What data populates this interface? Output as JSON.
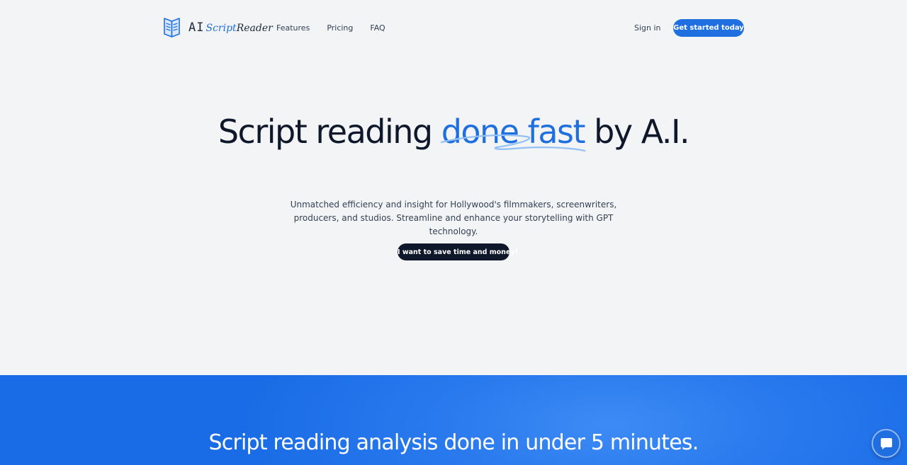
{
  "brand": {
    "ai": "AI",
    "script": "Script",
    "reader": "Reader",
    "logo_icon": "book-icon"
  },
  "nav": {
    "items": [
      {
        "label": "Features"
      },
      {
        "label": "Pricing"
      },
      {
        "label": "FAQ"
      }
    ],
    "sign_in": "Sign in",
    "get_started": "Get started today"
  },
  "hero": {
    "title_before": "Script reading ",
    "title_accent": "done fast",
    "title_after": " by A.I.",
    "subtitle": "Unmatched efficiency and insight for Hollywood's filmmakers, screenwriters, producers, and studios. Streamline and enhance your storytelling with GPT technology.",
    "cta": "I want to save time and money!"
  },
  "features": {
    "title": "Script reading analysis done in under 5 minutes."
  },
  "chat": {
    "icon": "chat-bubble-icon"
  },
  "colors": {
    "accent": "#1f6fe0",
    "dark": "#0f172a",
    "background": "#f3f4f6"
  }
}
